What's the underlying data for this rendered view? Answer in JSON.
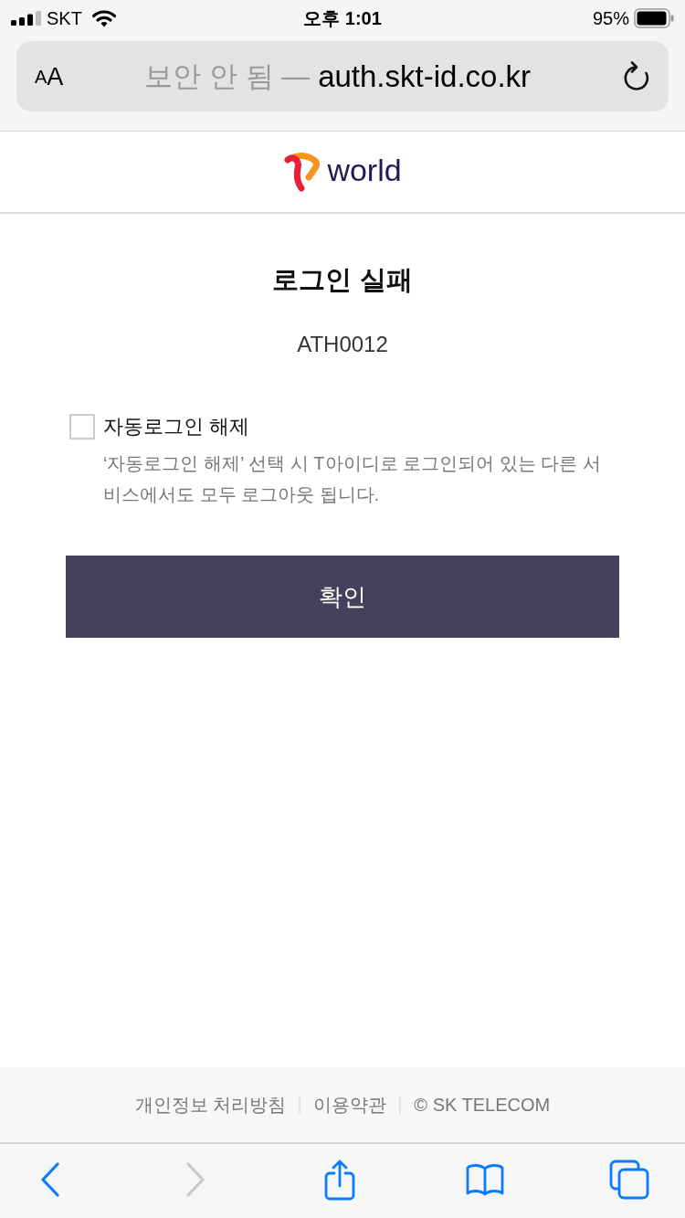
{
  "status_bar": {
    "carrier": "SKT",
    "time": "오후 1:01",
    "battery": "95%"
  },
  "address_bar": {
    "reader_button": [
      "A",
      "A"
    ],
    "security_label": "보안 안 됨 —",
    "domain": "auth.skt-id.co.kr"
  },
  "header": {
    "logo_text": "world"
  },
  "content": {
    "title": "로그인 실패",
    "error_code": "ATH0012",
    "checkbox": {
      "label": "자동로그인 해제",
      "checked": false
    },
    "description": "‘자동로그인 해제’ 선택 시 T아이디로 로그인되어 있는 다른 서비스에서도 모두 로그아웃 됩니다.",
    "confirm_button": "확인"
  },
  "footer": {
    "links": [
      "개인정보 처리방침",
      "이용약관"
    ],
    "copyright": "© SK TELECOM"
  },
  "toolbar": [
    {
      "kind": "back",
      "disabled": false
    },
    {
      "kind": "forward",
      "disabled": true
    },
    {
      "kind": "share",
      "disabled": false
    },
    {
      "kind": "bookmarks",
      "disabled": false
    },
    {
      "kind": "tabs",
      "disabled": false
    }
  ]
}
